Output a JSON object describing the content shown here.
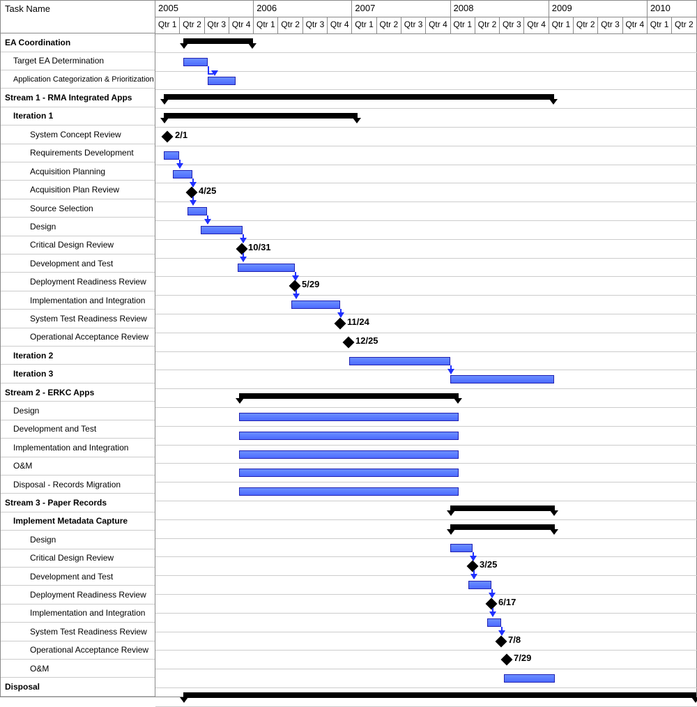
{
  "header": {
    "task_name_label": "Task Name"
  },
  "years": [
    "2005",
    "2006",
    "2007",
    "2008",
    "2009",
    "2010"
  ],
  "quarters": [
    "Qtr 1",
    "Qtr 2",
    "Qtr 3",
    "Qtr 4",
    "Qtr 1",
    "Qtr 2",
    "Qtr 3",
    "Qtr 4",
    "Qtr 1",
    "Qtr 2",
    "Qtr 3",
    "Qtr 4",
    "Qtr 1",
    "Qtr 2",
    "Qtr 3",
    "Qtr 4",
    "Qtr 1",
    "Qtr 2",
    "Qtr 3",
    "Qtr 4",
    "Qtr 1",
    "Qtr 2"
  ],
  "tasks": [
    {
      "name": "EA Coordination",
      "bold": true,
      "indent": 0
    },
    {
      "name": "Target EA Determination",
      "bold": false,
      "indent": 1
    },
    {
      "name": "Application Categorization & Prioritization",
      "bold": false,
      "indent": 1
    },
    {
      "name": "Stream 1 - RMA Integrated Apps",
      "bold": true,
      "indent": 0
    },
    {
      "name": "Iteration 1",
      "bold": true,
      "indent": 1
    },
    {
      "name": "System Concept Review",
      "bold": false,
      "indent": 2
    },
    {
      "name": "Requirements Development",
      "bold": false,
      "indent": 2
    },
    {
      "name": "Acquisition Planning",
      "bold": false,
      "indent": 2
    },
    {
      "name": "Acquisition Plan Review",
      "bold": false,
      "indent": 2
    },
    {
      "name": "Source Selection",
      "bold": false,
      "indent": 2
    },
    {
      "name": "Design",
      "bold": false,
      "indent": 2
    },
    {
      "name": "Critical Design Review",
      "bold": false,
      "indent": 2
    },
    {
      "name": "Development and Test",
      "bold": false,
      "indent": 2
    },
    {
      "name": "Deployment Readiness Review",
      "bold": false,
      "indent": 2
    },
    {
      "name": "Implementation and Integration",
      "bold": false,
      "indent": 2
    },
    {
      "name": "System Test Readiness Review",
      "bold": false,
      "indent": 2
    },
    {
      "name": "Operational Acceptance Review",
      "bold": false,
      "indent": 2
    },
    {
      "name": "Iteration 2",
      "bold": true,
      "indent": 1
    },
    {
      "name": "Iteration 3",
      "bold": true,
      "indent": 1
    },
    {
      "name": "Stream 2 - ERKC Apps",
      "bold": true,
      "indent": 0
    },
    {
      "name": "Design",
      "bold": false,
      "indent": 1
    },
    {
      "name": "Development and Test",
      "bold": false,
      "indent": 1
    },
    {
      "name": "Implementation and Integration",
      "bold": false,
      "indent": 1
    },
    {
      "name": "O&M",
      "bold": false,
      "indent": 1
    },
    {
      "name": "Disposal - Records Migration",
      "bold": false,
      "indent": 1
    },
    {
      "name": "Stream 3 - Paper Records",
      "bold": true,
      "indent": 0
    },
    {
      "name": "Implement Metadata Capture",
      "bold": true,
      "indent": 1
    },
    {
      "name": "Design",
      "bold": false,
      "indent": 2
    },
    {
      "name": "Critical Design Review",
      "bold": false,
      "indent": 2
    },
    {
      "name": "Development and Test",
      "bold": false,
      "indent": 2
    },
    {
      "name": "Deployment Readiness Review",
      "bold": false,
      "indent": 2
    },
    {
      "name": "Implementation and Integration",
      "bold": false,
      "indent": 2
    },
    {
      "name": "System Test Readiness Review",
      "bold": false,
      "indent": 2
    },
    {
      "name": "Operational Acceptance Review",
      "bold": false,
      "indent": 2
    },
    {
      "name": "O&M",
      "bold": false,
      "indent": 2
    },
    {
      "name": "Disposal",
      "bold": true,
      "indent": 0
    }
  ],
  "milestone_labels": {
    "m1": "2/1",
    "m2": "4/25",
    "m3": "10/31",
    "m4": "5/29",
    "m5": "11/24",
    "m6": "12/25",
    "m7": "3/25",
    "m8": "6/17",
    "m9": "7/8",
    "m10": "7/29"
  },
  "chart_data": {
    "type": "gantt",
    "time_unit": "quarter",
    "x_start": "2005-Q1",
    "x_end": "2010-Q2",
    "rows": [
      {
        "task": "EA Coordination",
        "kind": "summary",
        "start": "2005-Q2",
        "end": "2005-Q4"
      },
      {
        "task": "Target EA Determination",
        "kind": "bar",
        "start": "2005-Q2",
        "end": "2005-Q2"
      },
      {
        "task": "Application Categorization & Prioritization",
        "kind": "bar",
        "start": "2005-Q3",
        "end": "2005-Q3"
      },
      {
        "task": "Stream 1 - RMA Integrated Apps",
        "kind": "summary",
        "start": "2005-Q1",
        "end": "2009-Q1"
      },
      {
        "task": "Iteration 1",
        "kind": "summary",
        "start": "2005-Q1",
        "end": "2007-Q1"
      },
      {
        "task": "System Concept Review",
        "kind": "milestone",
        "date": "2/1",
        "quarter": "2005-Q1"
      },
      {
        "task": "Requirements Development",
        "kind": "bar",
        "start": "2005-Q1",
        "end": "2005-Q1"
      },
      {
        "task": "Acquisition Planning",
        "kind": "bar",
        "start": "2005-Q1",
        "end": "2005-Q2"
      },
      {
        "task": "Acquisition Plan Review",
        "kind": "milestone",
        "date": "4/25",
        "quarter": "2005-Q2"
      },
      {
        "task": "Source Selection",
        "kind": "bar",
        "start": "2005-Q2",
        "end": "2005-Q2"
      },
      {
        "task": "Design",
        "kind": "bar",
        "start": "2005-Q2",
        "end": "2005-Q4"
      },
      {
        "task": "Critical Design Review",
        "kind": "milestone",
        "date": "10/31",
        "quarter": "2005-Q4"
      },
      {
        "task": "Development and Test",
        "kind": "bar",
        "start": "2005-Q4",
        "end": "2006-Q2"
      },
      {
        "task": "Deployment Readiness Review",
        "kind": "milestone",
        "date": "5/29",
        "quarter": "2006-Q2"
      },
      {
        "task": "Implementation and Integration",
        "kind": "bar",
        "start": "2006-Q2",
        "end": "2006-Q4"
      },
      {
        "task": "System Test Readiness Review",
        "kind": "milestone",
        "date": "11/24",
        "quarter": "2006-Q4"
      },
      {
        "task": "Operational Acceptance Review",
        "kind": "milestone",
        "date": "12/25",
        "quarter": "2006-Q4"
      },
      {
        "task": "Iteration 2",
        "kind": "bar",
        "start": "2007-Q1",
        "end": "2008-Q1"
      },
      {
        "task": "Iteration 3",
        "kind": "bar",
        "start": "2008-Q1",
        "end": "2009-Q1"
      },
      {
        "task": "Stream 2 - ERKC Apps",
        "kind": "summary",
        "start": "2005-Q4",
        "end": "2008-Q1"
      },
      {
        "task": "Design",
        "kind": "bar",
        "start": "2005-Q4",
        "end": "2008-Q1"
      },
      {
        "task": "Development and Test",
        "kind": "bar",
        "start": "2005-Q4",
        "end": "2008-Q1"
      },
      {
        "task": "Implementation and Integration",
        "kind": "bar",
        "start": "2005-Q4",
        "end": "2008-Q1"
      },
      {
        "task": "O&M",
        "kind": "bar",
        "start": "2005-Q4",
        "end": "2008-Q1"
      },
      {
        "task": "Disposal - Records Migration",
        "kind": "bar",
        "start": "2005-Q4",
        "end": "2008-Q1"
      },
      {
        "task": "Stream 3 - Paper Records",
        "kind": "summary",
        "start": "2008-Q1",
        "end": "2009-Q1"
      },
      {
        "task": "Implement Metadata Capture",
        "kind": "summary",
        "start": "2008-Q1",
        "end": "2009-Q1"
      },
      {
        "task": "Design",
        "kind": "bar",
        "start": "2008-Q1",
        "end": "2008-Q1"
      },
      {
        "task": "Critical Design Review",
        "kind": "milestone",
        "date": "3/25",
        "quarter": "2008-Q1"
      },
      {
        "task": "Development and Test",
        "kind": "bar",
        "start": "2008-Q1",
        "end": "2008-Q2"
      },
      {
        "task": "Deployment Readiness Review",
        "kind": "milestone",
        "date": "6/17",
        "quarter": "2008-Q2"
      },
      {
        "task": "Implementation and Integration",
        "kind": "bar",
        "start": "2008-Q2",
        "end": "2008-Q3"
      },
      {
        "task": "System Test Readiness Review",
        "kind": "milestone",
        "date": "7/8",
        "quarter": "2008-Q3"
      },
      {
        "task": "Operational Acceptance Review",
        "kind": "milestone",
        "date": "7/29",
        "quarter": "2008-Q3"
      },
      {
        "task": "O&M",
        "kind": "bar",
        "start": "2008-Q3",
        "end": "2009-Q1"
      },
      {
        "task": "Disposal",
        "kind": "summary_open",
        "start": "2005-Q2",
        "end": "2010-Q2"
      }
    ]
  }
}
